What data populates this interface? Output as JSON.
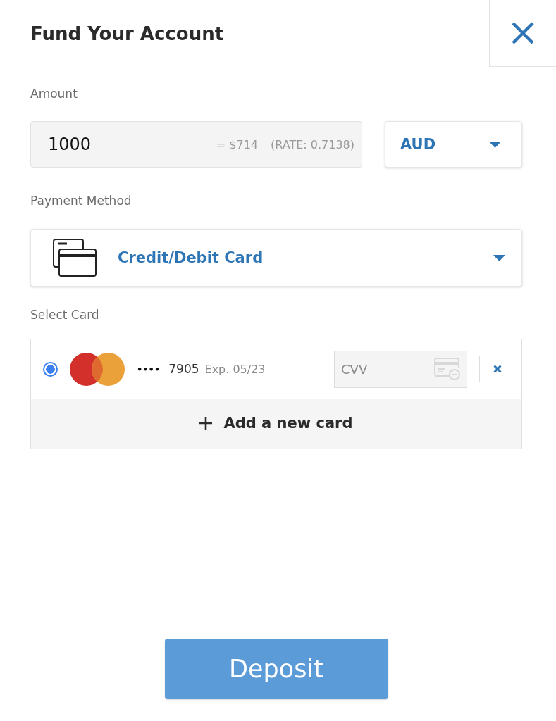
{
  "title": "Fund Your Account",
  "amount": {
    "label": "Amount",
    "value": "1000",
    "converted": "= $714",
    "rate": "(RATE: 0.7138)",
    "currency": "AUD"
  },
  "payment_method": {
    "label": "Payment Method",
    "value": "Credit/Debit Card"
  },
  "select_card": {
    "label": "Select Card",
    "cards": [
      {
        "selected": true,
        "mask": "••••",
        "last4": "7905",
        "expiry": "Exp. 05/23",
        "cvv_placeholder": "CVV"
      }
    ],
    "add_card": "Add a new card"
  },
  "deposit_button": "Deposit"
}
